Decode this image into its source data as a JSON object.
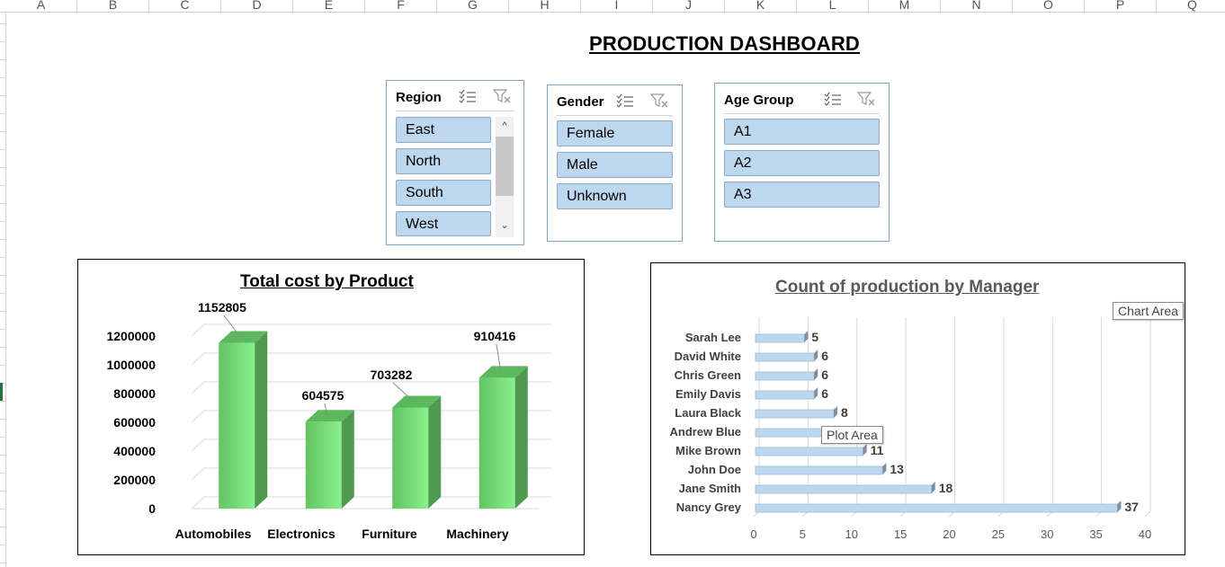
{
  "sheet": {
    "columns": [
      "A",
      "B",
      "C",
      "D",
      "E",
      "F",
      "G",
      "H",
      "I",
      "J",
      "K",
      "L",
      "M",
      "N",
      "O",
      "P",
      "Q"
    ]
  },
  "dashboard": {
    "title": "PRODUCTION DASHBOARD"
  },
  "slicers": {
    "region": {
      "title": "Region",
      "items": [
        "East",
        "North",
        "South",
        "West"
      ]
    },
    "gender": {
      "title": "Gender",
      "items": [
        "Female",
        "Male",
        "Unknown"
      ]
    },
    "age_group": {
      "title": "Age Group",
      "items": [
        "A1",
        "A2",
        "A3"
      ]
    }
  },
  "tooltips": {
    "chart_area": "Chart Area",
    "plot_area": "Plot Area"
  },
  "colors": {
    "slicer_item": "#bdd7ee",
    "bar_green": "#7dd87d",
    "bar_blue": "#bdd7ee"
  },
  "chart_data": [
    {
      "type": "bar",
      "title": "Total cost by Product",
      "categories": [
        "Automobiles",
        "Electronics",
        "Furniture",
        "Machinery"
      ],
      "values": [
        1152805,
        604575,
        703282,
        910416
      ],
      "y_ticks": [
        "0",
        "200000",
        "400000",
        "600000",
        "800000",
        "1000000",
        "1200000"
      ],
      "ylim": [
        0,
        1200000
      ],
      "grid": true,
      "style": "3d-column"
    },
    {
      "type": "bar",
      "orientation": "horizontal",
      "title": "Count of production by Manager",
      "categories": [
        "Sarah Lee",
        "David White",
        "Chris Green",
        "Emily Davis",
        "Laura Black",
        "Andrew Blue",
        "Mike Brown",
        "John Doe",
        "Jane Smith",
        "Nancy Grey"
      ],
      "values": [
        5,
        6,
        6,
        6,
        8,
        10,
        11,
        13,
        18,
        37
      ],
      "value_labels": [
        "5",
        "6",
        "6",
        "6",
        "8",
        "",
        "11",
        "13",
        "18",
        "37"
      ],
      "x_ticks": [
        "0",
        "5",
        "10",
        "15",
        "20",
        "25",
        "30",
        "35",
        "40"
      ],
      "xlim": [
        0,
        40
      ],
      "grid": true
    }
  ]
}
